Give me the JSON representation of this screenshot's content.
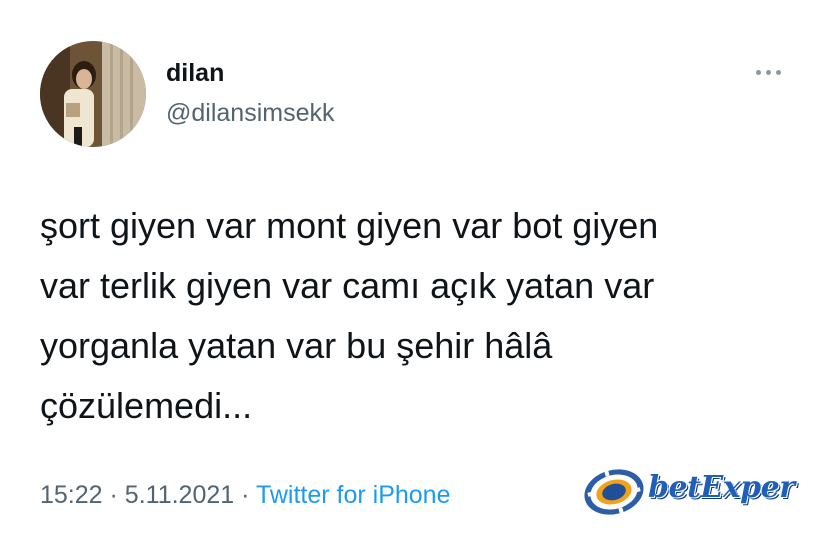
{
  "tweet": {
    "author": {
      "display_name": "dilan",
      "handle": "@dilansimsekk"
    },
    "text_lines": [
      "şort giyen var mont giyen var bot giyen",
      "var terlik giyen var camı açık yatan var",
      "yorganla yatan var bu şehir hâlâ",
      "çözülemedi..."
    ],
    "time": "15:22",
    "date": "5.11.2021",
    "separator": "·",
    "source": "Twitter for iPhone",
    "more_icon": "more-horizontal-icon"
  },
  "watermark": {
    "text": "betExper",
    "icon": "chip-logo-icon"
  },
  "colors": {
    "text": "#0f1419",
    "secondary": "#536471",
    "link": "#1d9bf0",
    "watermark": "#1f5fb8"
  }
}
